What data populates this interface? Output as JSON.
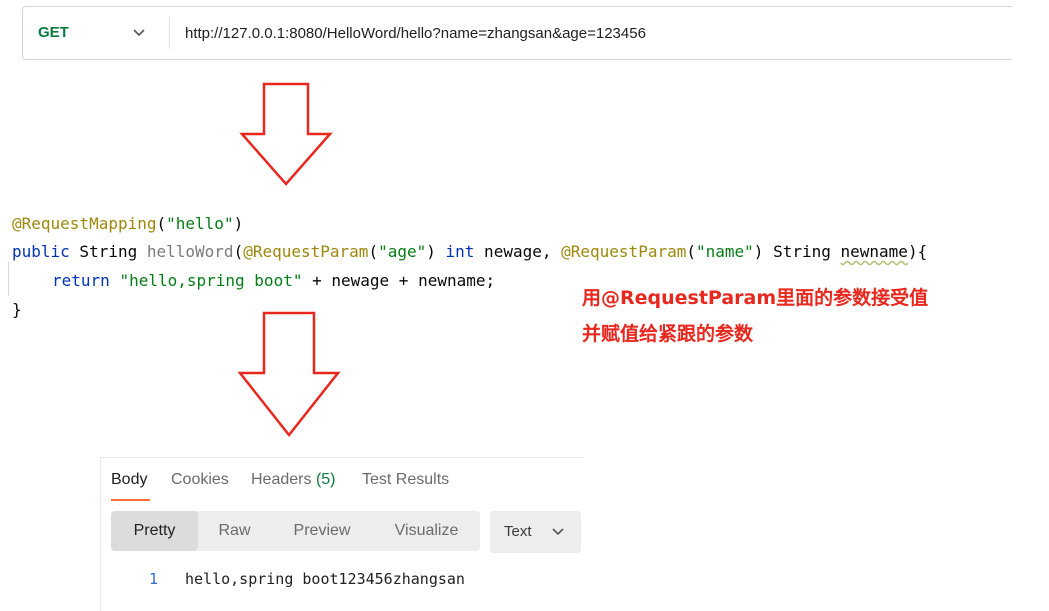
{
  "request": {
    "method": "GET",
    "url": "http://127.0.0.1:8080/HelloWord/hello?name=zhangsan&age=123456"
  },
  "code": {
    "line1": {
      "annotation": "@RequestMapping",
      "open": "(",
      "string": "\"hello\"",
      "close": ")"
    },
    "line2": {
      "kw_public": "public",
      "type_string": " String ",
      "method_name": "helloWord",
      "paren_open": "(",
      "annotation1": "@RequestParam",
      "p1_open": "(",
      "p1_string": "\"age\"",
      "p1_close": ") ",
      "kw_int": "int",
      "p1_var": " newage, ",
      "annotation2": "@RequestParam",
      "p2_open": "(",
      "p2_string": "\"name\"",
      "p2_close": ") String ",
      "p2_var": "newname",
      "tail": "){"
    },
    "line3": {
      "kw_return": "return",
      "space": " ",
      "string": "\"hello,spring boot\"",
      "rest": " + newage + newname;"
    },
    "line4": {
      "brace": "}"
    }
  },
  "annotation_note": {
    "line1": "用@RequestParam里面的参数接受值",
    "line2": "并赋值给紧跟的参数"
  },
  "response": {
    "tabs": [
      "Body",
      "Cookies",
      "Headers",
      "Test Results"
    ],
    "headers_count": "(5)",
    "views": [
      "Pretty",
      "Raw",
      "Preview",
      "Visualize"
    ],
    "format": "Text",
    "line_number": "1",
    "body": "hello,spring boot123456zhangsan"
  },
  "colors": {
    "method_green": "#0b7a3f",
    "arrow_red": "#e8281e",
    "note_red": "#e8281e",
    "active_tab_underline": "#ff6c37"
  }
}
